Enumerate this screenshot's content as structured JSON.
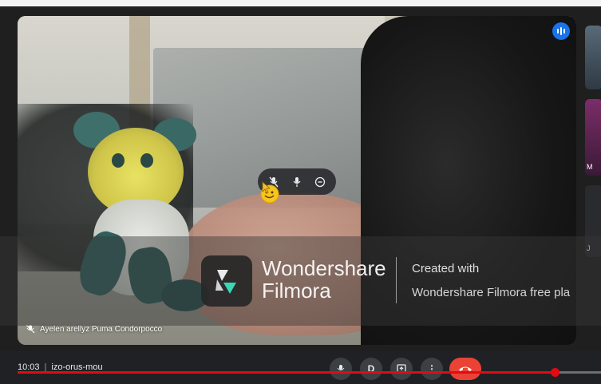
{
  "meeting": {
    "time": "10:03",
    "code": "izo-orus-mou"
  },
  "participant": {
    "name": "Ayelen arellyz Puma Condorpocco",
    "mic_muted": true
  },
  "watermark": {
    "brand_line1": "Wondershare",
    "brand_line2": "Filmora",
    "created_with": "Created with",
    "product": "Wondershare Filmora free pla"
  },
  "thumbnails": [
    {
      "label": ""
    },
    {
      "label": "M"
    },
    {
      "label": "J"
    }
  ],
  "playback": {
    "progress": 0.92
  },
  "icons": {
    "audio": "audio-level-icon",
    "mic_off": "mic-off-icon",
    "mic": "mic-icon",
    "remove": "remove-icon",
    "emoji": "emoji-cursor-icon",
    "present": "present-icon",
    "info": "info-icon",
    "end_call": "end-call-icon"
  },
  "colors": {
    "accent": "#1a73e8",
    "end_call": "#ea4335",
    "progress": "#e50914"
  }
}
